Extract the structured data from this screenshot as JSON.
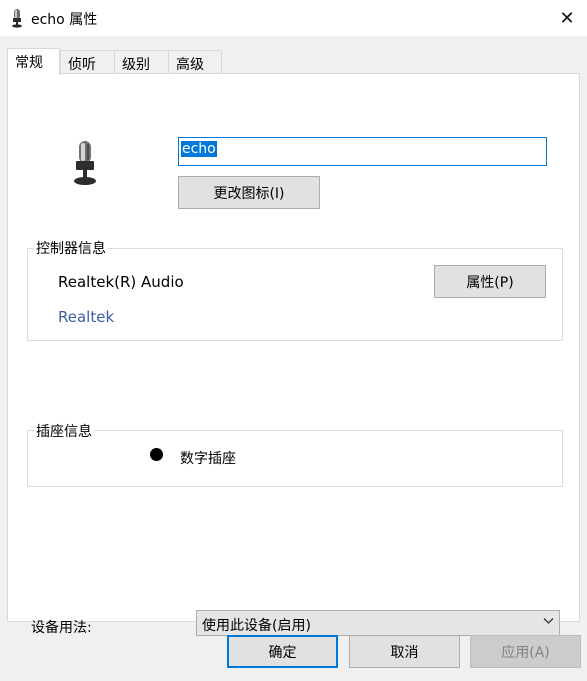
{
  "window": {
    "title": "echo 属性",
    "close_glyph": "✕"
  },
  "tabs": [
    {
      "label": "常规",
      "active": true
    },
    {
      "label": "侦听",
      "active": false
    },
    {
      "label": "级别",
      "active": false
    },
    {
      "label": "高级",
      "active": false
    }
  ],
  "general": {
    "device_name_value": "echo",
    "change_icon_label": "更改图标(I)",
    "controller": {
      "group_title": "控制器信息",
      "name": "Realtek(R) Audio",
      "vendor_link": "Realtek",
      "properties_label": "属性(P)"
    },
    "jack": {
      "group_title": "插座信息",
      "type": "数字插座"
    },
    "device_usage": {
      "label": "设备用法:",
      "selected": "使用此设备(启用)"
    }
  },
  "footer": {
    "ok_label": "确定",
    "cancel_label": "取消",
    "apply_label": "应用(A)"
  },
  "colors": {
    "accent": "#0078d7",
    "link": "#3d5ea3",
    "dialog_bg": "#f0f0f0"
  },
  "icons": {
    "title": "microphone-icon",
    "device": "microphone-icon",
    "close": "close-icon",
    "dropdown": "chevron-down-icon"
  }
}
